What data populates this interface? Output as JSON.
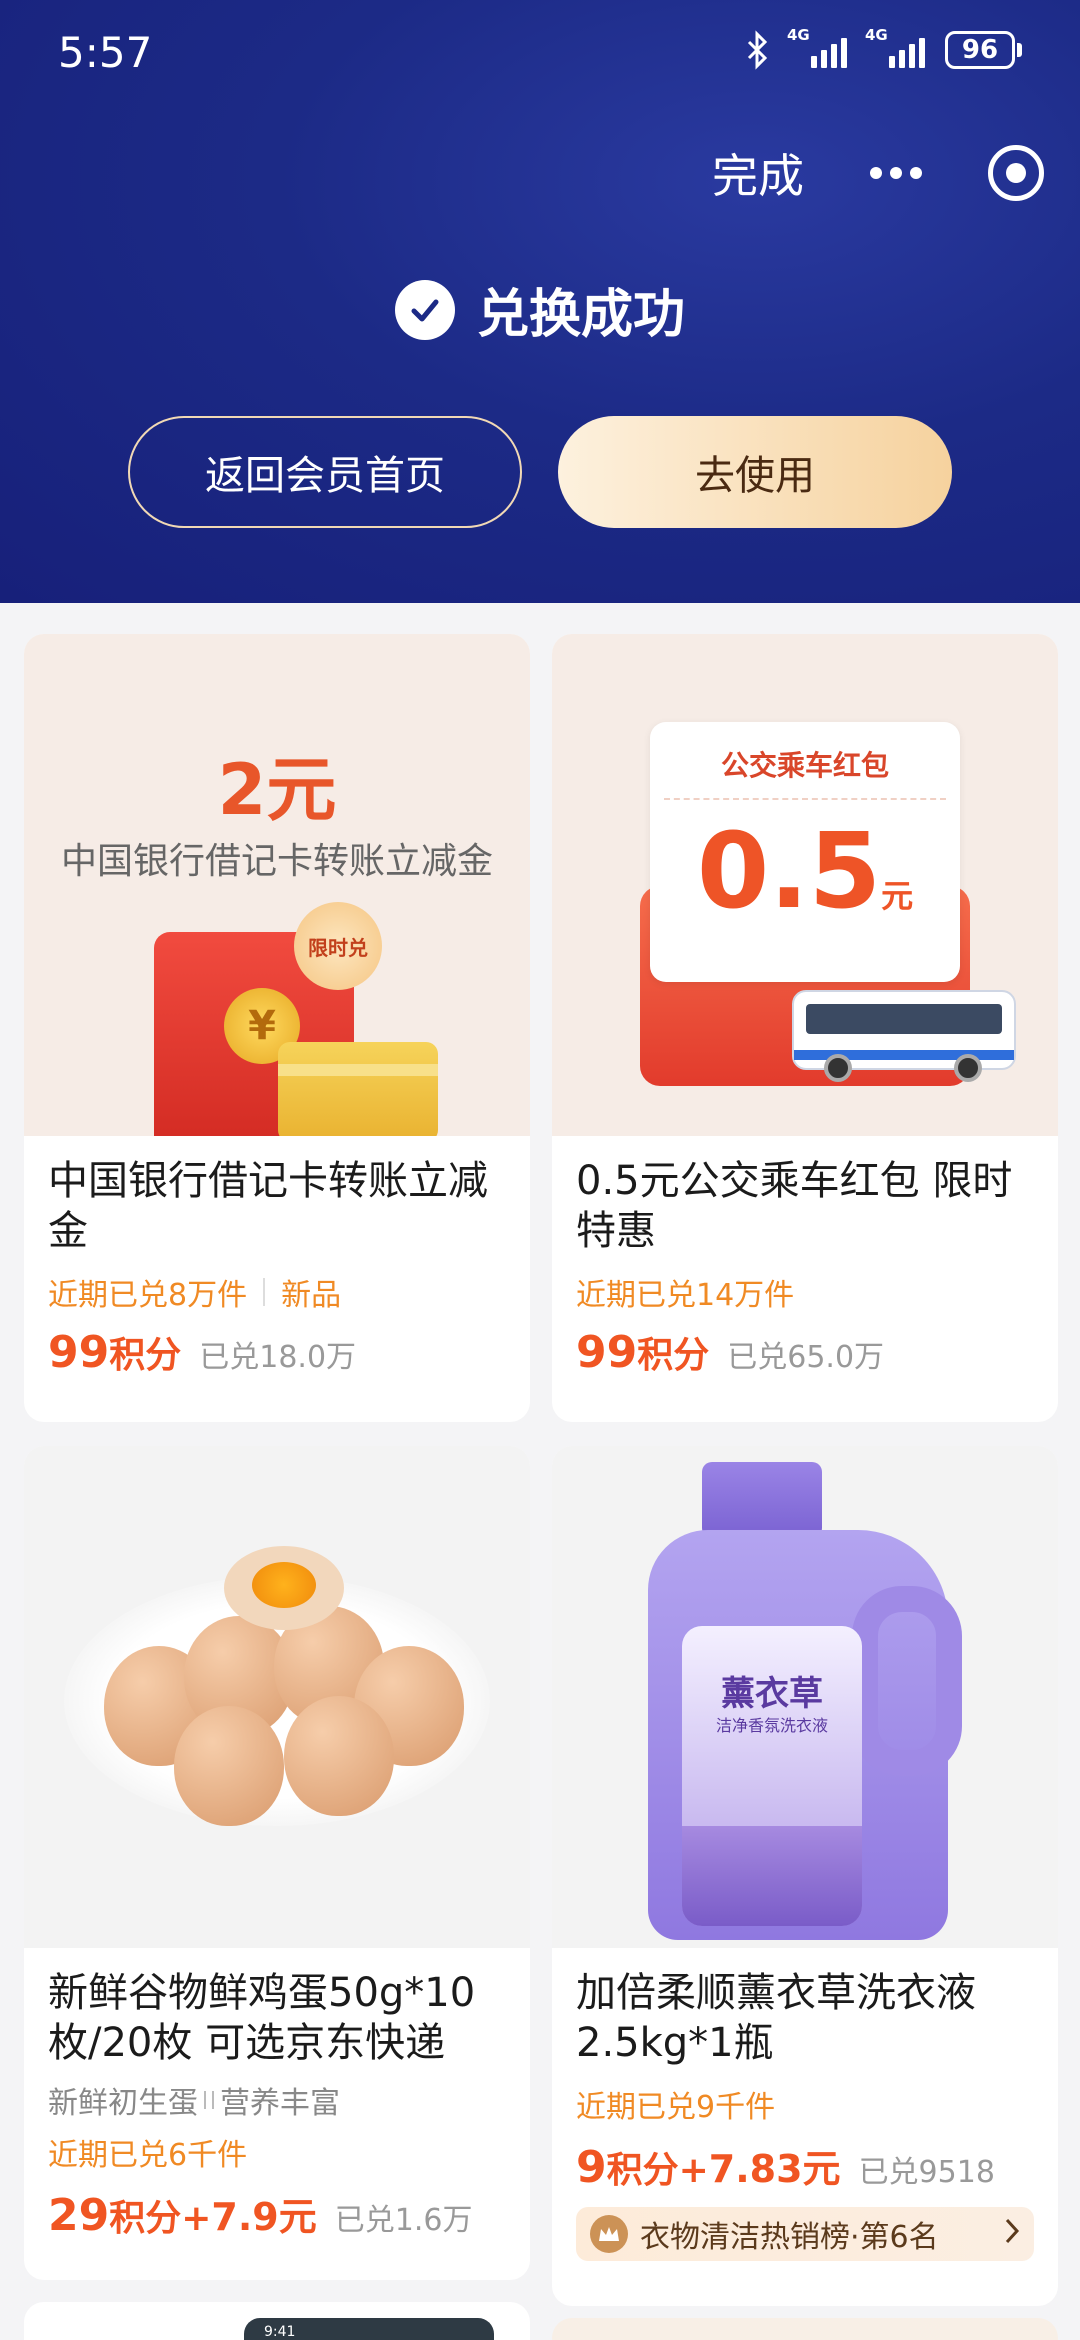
{
  "status": {
    "time": "5:57",
    "net1": "4G",
    "net2": "4G",
    "battery": "96"
  },
  "header": {
    "done_label": "完成",
    "success_text": "兑换成功",
    "back_button": "返回会员首页",
    "use_button": "去使用"
  },
  "cards": [
    {
      "img_title": "2元",
      "img_subtitle": "中国银行借记卡转账立减金",
      "img_badge": "限时兑",
      "img_coin": "¥",
      "title": "中国银行借记卡转账立减金",
      "meta": "近期已兑8万件",
      "meta_tag": "新品",
      "price_num": "99",
      "price_unit": "积分",
      "sold": "已兑18.0万"
    },
    {
      "img_ticket_title": "公交乘车红包",
      "img_amount": "0.5",
      "img_amount_unit": "元",
      "title": "0.5元公交乘车红包 限时特惠",
      "meta": "近期已兑14万件",
      "price_num": "99",
      "price_unit": "积分",
      "sold": "已兑65.0万"
    },
    {
      "title": "新鲜谷物鲜鸡蛋50g*10枚/20枚 可选京东快递",
      "tag1": "新鲜初生蛋",
      "tag2": "营养丰富",
      "meta": "近期已兑6千件",
      "price_num": "29",
      "price_unit": "积分+",
      "price_extra": "7.9元",
      "sold": "已兑1.6万"
    },
    {
      "img_bottle_label": "薰衣草",
      "img_bottle_sub": "洁净香氛洗衣液",
      "title": "加倍柔顺薰衣草洗衣液2.5kg*1瓶",
      "meta": "近期已兑9千件",
      "price_num": "9",
      "price_unit": "积分+",
      "price_extra": "7.83元",
      "sold": "已兑9518",
      "rank": "衣物清洁热销榜·第6名"
    }
  ],
  "partial_card_time": "9:41"
}
